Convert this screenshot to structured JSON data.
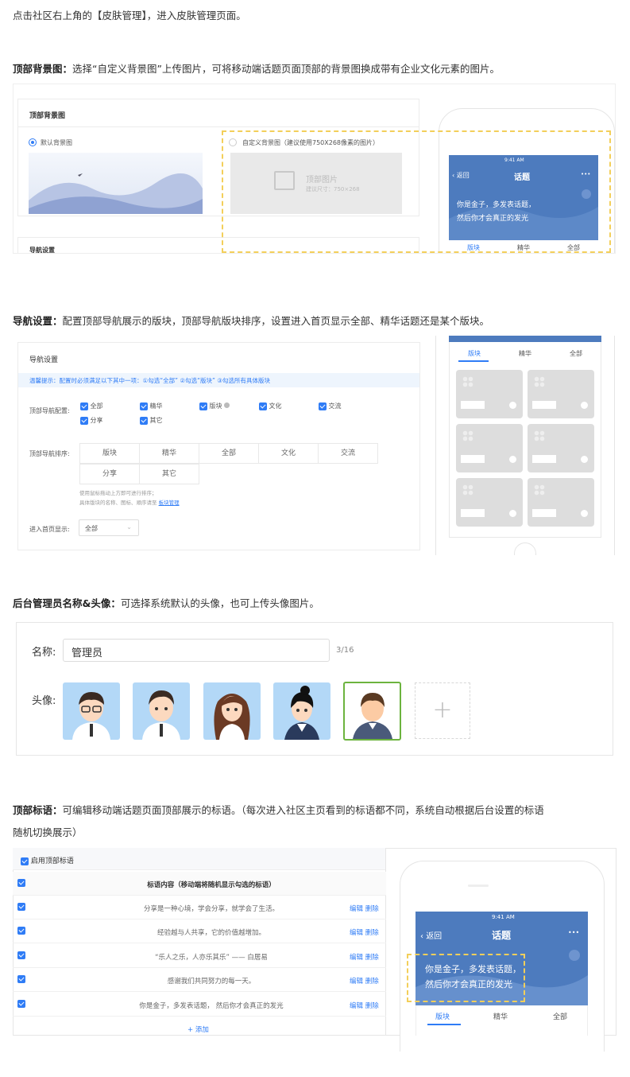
{
  "intro": "点击社区右上角的【皮肤管理】，进入皮肤管理页面。",
  "section1": {
    "title": "顶部背景图：",
    "desc": "选择“自定义背景图”上传图片，可将移动端话题页面顶部的背景图换成带有企业文化元素的图片。",
    "panel_title": "顶部背景图",
    "default_label": "默认背景图",
    "custom_label": "自定义背景图（建议使用750X268像素的图片）",
    "upload_title": "顶部图片",
    "upload_hint": "建议尺寸：750×268",
    "next_panel": "导航设置",
    "phone": {
      "time": "9:41 AM",
      "back": "返回",
      "title": "话题",
      "more": "•••",
      "slogan1": "你是金子，多发表话题，",
      "slogan2": "然后你才会真正的发光",
      "tabs": [
        "版块",
        "精华",
        "全部"
      ]
    }
  },
  "section2": {
    "title": "导航设置：",
    "desc": "配置顶部导航展示的版块，顶部导航版块排序，设置进入首页显示全部、精华话题还是某个版块。",
    "panel_title": "导航设置",
    "tip": "温馨提示：配置时必须满足以下其中一项：①勾选“全部” ②勾选“版块” ③勾选所有具体版块",
    "config_label": "顶部导航配置:",
    "options": [
      "全部",
      "精华",
      "版块",
      "文化",
      "交流",
      "分享",
      "其它"
    ],
    "order_label": "顶部导航排序:",
    "order": [
      "版块",
      "精华",
      "全部",
      "文化",
      "交流",
      "分享",
      "其它"
    ],
    "order_hint1": "使用鼠标拖动上方即可进行排序；",
    "order_hint2": "具体版块的名称、图标、顺序请至",
    "order_link": "板块管理",
    "home_label": "进入首页显示:",
    "home_value": "全部",
    "phone_tabs": [
      "版块",
      "精华",
      "全部"
    ]
  },
  "section3": {
    "title": "后台管理员名称&头像：",
    "desc": "可选择系统默认的头像，也可上传头像图片。",
    "name_label": "名称:",
    "name_value": "管理员",
    "name_count": "3/16",
    "avatar_label": "头像:",
    "add": "+"
  },
  "section4": {
    "title": "顶部标语：",
    "desc1": "可编辑移动端话题页面顶部展示的标语。（每次进入社区主页看到的标语都不同，系统自动根据后台设置的标语",
    "desc2": "随机切换展示）",
    "enable": "启用顶部标语",
    "header": "标语内容（移动端将随机显示勾选的标语）",
    "rows": [
      "分享是一种心境，学会分享，就学会了生活。",
      "经验越与人共享，它的价值越增加。",
      "“乐人之乐，人亦乐其乐” —— 白居易",
      "感谢我们共同努力的每一天。",
      "你是金子，多发表话题， 然后你才会真正的发光"
    ],
    "edit": "编辑",
    "del": "删除",
    "add": "+ 添加",
    "phone": {
      "time": "9:41 AM",
      "back": "返回",
      "title": "话题",
      "more": "•••",
      "slogan1": "你是金子，多发表话题，",
      "slogan2": "然后你才会真正的发光",
      "tabs": [
        "版块",
        "精华",
        "全部"
      ]
    }
  },
  "colors": {
    "accent": "#2f7cf6",
    "phone_header": "#4a78b8",
    "dashed": "#f3cf5a",
    "selected_avatar": "#6cb33e"
  }
}
